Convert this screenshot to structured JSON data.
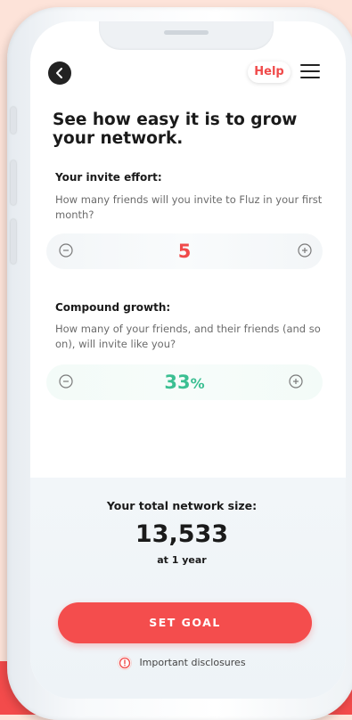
{
  "header": {
    "back_icon": "chevron-left-icon",
    "help_label": "Help",
    "menu_icon": "hamburger-menu-icon"
  },
  "title": "See how easy it is to grow your network.",
  "invite_effort": {
    "label": "Your invite effort:",
    "help": "How many friends will you invite to Fluz in your first month?",
    "value": "5",
    "minus_icon": "minus-circle-icon",
    "plus_icon": "plus-circle-icon"
  },
  "compound_growth": {
    "label": "Compound growth:",
    "help": "How many of your friends, and their friends (and so on), will invite like you?",
    "value": "33",
    "unit": "%",
    "minus_icon": "minus-circle-icon",
    "plus_icon": "plus-circle-icon"
  },
  "total": {
    "label": "Your total network size:",
    "value": "13,533",
    "period": "at 1 year"
  },
  "set_goal_label": "SET GOAL",
  "disclosure": {
    "label": "Important disclosures",
    "icon": "info-circle-icon"
  },
  "colors": {
    "accent_red": "#f44d4d",
    "accent_green": "#3bbf92",
    "background_peach": "#fde3d9"
  }
}
